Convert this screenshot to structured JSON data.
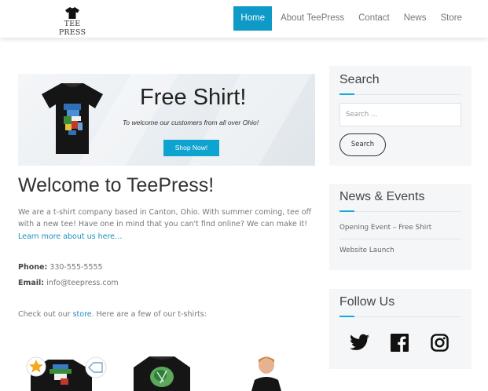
{
  "header": {
    "logo_text": "TEE PRESS",
    "nav": [
      {
        "label": "Home",
        "active": true
      },
      {
        "label": "About TeePress",
        "active": false
      },
      {
        "label": "Contact",
        "active": false
      },
      {
        "label": "News",
        "active": false
      },
      {
        "label": "Store",
        "active": false
      }
    ]
  },
  "banner": {
    "title": "Free Shirt!",
    "subtitle": "To welcome our customers from all over Ohio!",
    "button_label": "Shop Now!"
  },
  "main": {
    "heading": "Welcome to TeePress!",
    "intro": "We are a t-shirt company based in Canton, Ohio.  With summer coming, tee off with a new tee! Have one in mind that you can't find online? We can make it!",
    "learn_more": "Learn more about us here…",
    "phone_label": "Phone:",
    "phone_value": "330-555-5555",
    "email_label": "Email:",
    "email_value": "info@teepress.com",
    "store_prefix": "Check out our",
    "store_link": "store",
    "store_suffix": ". Here are a few of our t-shirts:"
  },
  "sidebar": {
    "search": {
      "title": "Search",
      "placeholder": "Search …",
      "button_label": "Search"
    },
    "news": {
      "title": "News & Events",
      "items": [
        "Opening Event – Free Shirt",
        "Website Launch"
      ]
    },
    "follow": {
      "title": "Follow Us",
      "icons": [
        "twitter-icon",
        "facebook-icon",
        "instagram-icon"
      ]
    }
  },
  "colors": {
    "accent": "#0f99c6",
    "link": "#1b8fbd",
    "widget_bg": "#f4f6f8"
  }
}
